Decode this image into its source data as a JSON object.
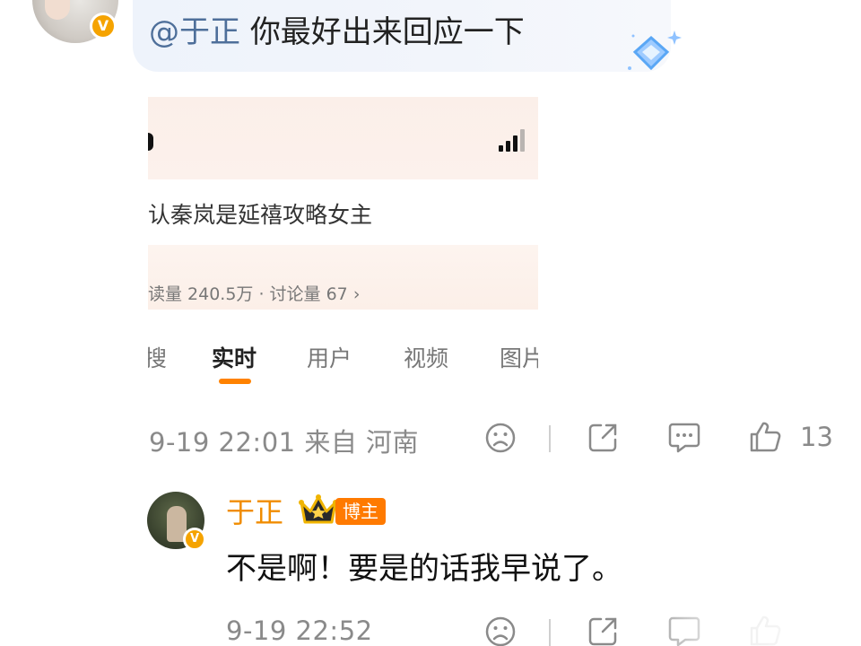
{
  "comment": {
    "mention": "@于正",
    "text": "你最好出来回应一下",
    "time_location": "9-19 22:01  来自 河南",
    "like_count": "13",
    "icons": [
      "sad-face-icon",
      "share-icon",
      "comment-icon",
      "like-icon"
    ]
  },
  "embedded_screenshot": {
    "topic_title": "认秦岚是延禧攻略女主",
    "stats": "读量 240.5万 · 讨论量 67",
    "tabs": [
      "搜",
      "实时",
      "用户",
      "视频",
      "图片"
    ],
    "active_tab": "实时"
  },
  "reply": {
    "author": "于正",
    "badge": "博主",
    "text": "不是啊！要是的话我早说了。",
    "time": "9-19 22:52"
  },
  "colors": {
    "mention": "#4e6f9a",
    "author": "#f08c00",
    "badge_bg": "#ff7a00",
    "tab_underline": "#ff8200",
    "meta_gray": "#8a8a8a"
  }
}
